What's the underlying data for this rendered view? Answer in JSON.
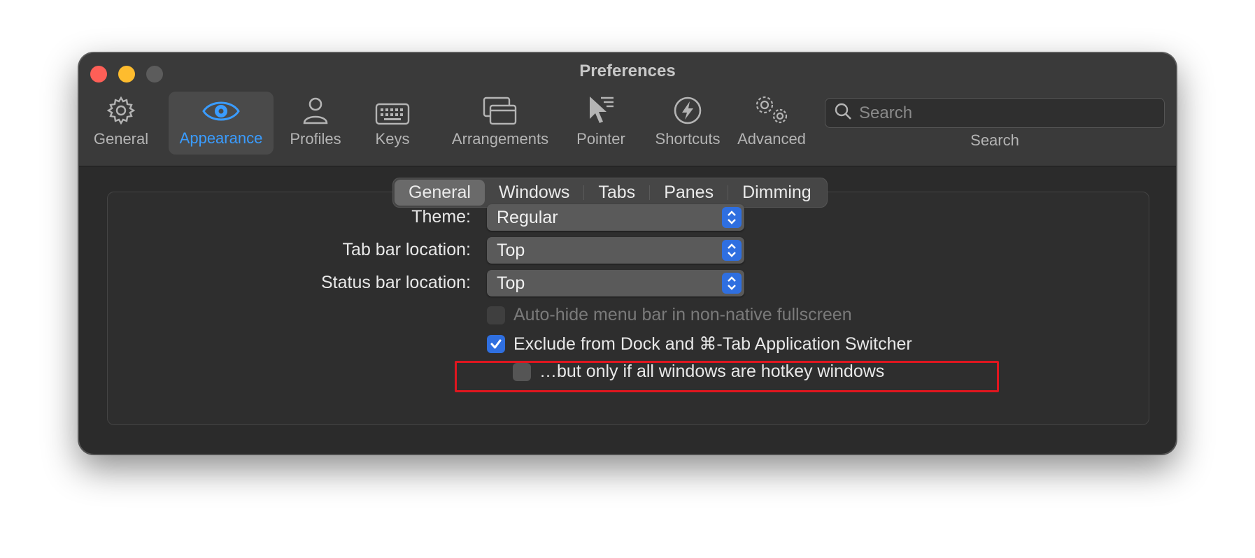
{
  "window": {
    "title": "Preferences"
  },
  "toolbar": {
    "items": [
      {
        "label": "General",
        "icon": "gear-icon"
      },
      {
        "label": "Appearance",
        "icon": "eye-icon",
        "selected": true
      },
      {
        "label": "Profiles",
        "icon": "person-icon"
      },
      {
        "label": "Keys",
        "icon": "keyboard-icon"
      },
      {
        "label": "Arrangements",
        "icon": "windows-icon"
      },
      {
        "label": "Pointer",
        "icon": "pointer-icon"
      },
      {
        "label": "Shortcuts",
        "icon": "bolt-icon"
      },
      {
        "label": "Advanced",
        "icon": "gears-icon"
      }
    ],
    "search": {
      "placeholder": "Search",
      "label": "Search"
    }
  },
  "tabs": {
    "items": [
      "General",
      "Windows",
      "Tabs",
      "Panes",
      "Dimming"
    ],
    "active": "General"
  },
  "settings": {
    "theme": {
      "label": "Theme:",
      "value": "Regular"
    },
    "tab_bar": {
      "label": "Tab bar location:",
      "value": "Top"
    },
    "status_bar": {
      "label": "Status bar location:",
      "value": "Top"
    },
    "auto_hide": {
      "label": "Auto-hide menu bar in non-native fullscreen",
      "checked": false,
      "enabled": false
    },
    "exclude_dock": {
      "label": "Exclude from Dock and ⌘-Tab Application Switcher",
      "checked": true,
      "enabled": true
    },
    "hotkey_only": {
      "label": "…but only if all windows are hotkey windows",
      "checked": false,
      "enabled": true
    }
  },
  "colors": {
    "accent": "#3a9cff",
    "highlight": "#e0161f",
    "checkbox": "#2f6fe0"
  }
}
